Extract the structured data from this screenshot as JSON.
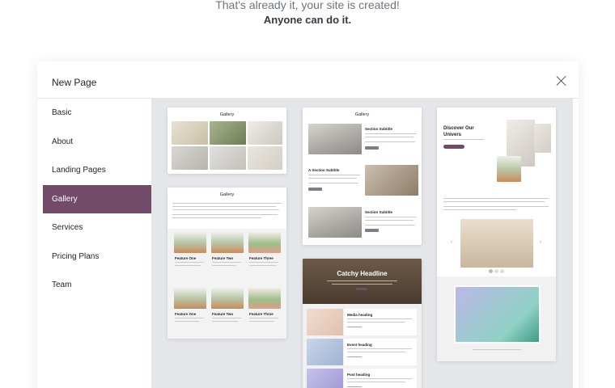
{
  "hero": {
    "subtitle": "That's already it, your site is created!",
    "emphasis": "Anyone can do it."
  },
  "modal": {
    "title": "New Page",
    "close_icon": "close-icon"
  },
  "sidebar": {
    "active_index": 3,
    "items": [
      {
        "label": "Basic"
      },
      {
        "label": "About"
      },
      {
        "label": "Landing Pages"
      },
      {
        "label": "Gallery"
      },
      {
        "label": "Services"
      },
      {
        "label": "Pricing Plans"
      },
      {
        "label": "Team"
      }
    ]
  },
  "templates": {
    "gallery_grid": {
      "title": "Gallery"
    },
    "gallery_features": {
      "title": "Gallery",
      "features": [
        "Feature One",
        "Feature Two",
        "Feature Three",
        "Feature One",
        "Feature Two",
        "Feature Three"
      ]
    },
    "gallery_sections": {
      "title": "Gallery",
      "subtitle_1": "Section Subtitle",
      "subtitle_2": "A Section Subtitle",
      "subtitle_3": "Section Subtitle"
    },
    "catchy": {
      "headline": "Catchy Headline",
      "items": [
        "Media heading",
        "Event heading",
        "Post heading"
      ]
    },
    "discover": {
      "title_line1": "Discover Our",
      "title_line2": "Univers"
    }
  },
  "colors": {
    "accent": "#714b67",
    "canvas": "#e4e6ea"
  }
}
